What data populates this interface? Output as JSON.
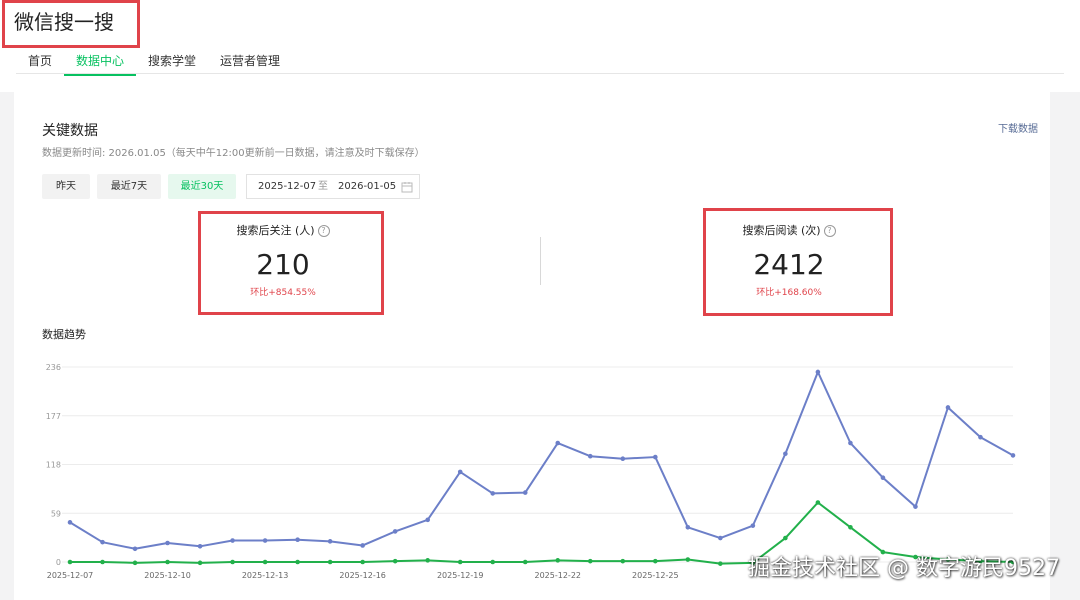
{
  "app": {
    "title": "微信搜一搜"
  },
  "nav": {
    "tabs": [
      "首页",
      "数据中心",
      "搜索学堂",
      "运营者管理"
    ],
    "active_index": 1
  },
  "key_data": {
    "title": "关键数据",
    "updated": "数据更新时间: 2026.01.05（每天中午12:00更新前一日数据，请注意及时下载保存）",
    "download": "下载数据"
  },
  "filters": {
    "buttons": [
      "昨天",
      "最近7天",
      "最近30天"
    ],
    "active_index": 2,
    "date_start": "2025-12-07",
    "date_sep": "至",
    "date_end": "2026-01-05"
  },
  "metrics": [
    {
      "label": "搜索后关注 (人)",
      "value": "210",
      "change": "环比+854.55%"
    },
    {
      "label": "搜索后阅读 (次)",
      "value": "2412",
      "change": "环比+168.60%"
    }
  ],
  "trend": {
    "title": "数据趋势"
  },
  "watermark": "掘金技术社区 @ 数字游民9527",
  "colors": {
    "accent": "#07c160",
    "highlight": "#e0434a",
    "reads": "#6c7fc8",
    "follows": "#22b04b"
  },
  "chart_data": {
    "type": "line",
    "x": [
      "2025-12-07",
      "2025-12-08",
      "2025-12-09",
      "2025-12-10",
      "2025-12-11",
      "2025-12-12",
      "2025-12-13",
      "2025-12-14",
      "2025-12-15",
      "2025-12-16",
      "2025-12-17",
      "2025-12-18",
      "2025-12-19",
      "2025-12-20",
      "2025-12-21",
      "2025-12-22",
      "2025-12-23",
      "2025-12-24",
      "2025-12-25",
      "2025-12-26",
      "2025-12-27",
      "2025-12-28",
      "2025-12-29",
      "2025-12-30",
      "2025-12-31",
      "2026-01-01",
      "2026-01-02",
      "2026-01-03",
      "2026-01-04",
      "2026-01-05"
    ],
    "x_tick_labels": [
      "2025-12-07",
      "2025-12-10",
      "2025-12-13",
      "2025-12-16",
      "2025-12-19",
      "2025-12-22",
      "2025-12-25"
    ],
    "yticks": [
      0,
      59,
      118,
      177,
      236
    ],
    "ylim": [
      0,
      236
    ],
    "grid": true,
    "series": [
      {
        "values": [
          48,
          24,
          16,
          23,
          19,
          26,
          26,
          27,
          25,
          20,
          37,
          51,
          109,
          83,
          84,
          144,
          128,
          125,
          127,
          42,
          29,
          44,
          131,
          230,
          144,
          102,
          67,
          187,
          151,
          129
        ],
        "color": "#6c7fc8"
      },
      {
        "values": [
          0,
          0,
          -1,
          0,
          -1,
          0,
          0,
          0,
          0,
          0,
          1,
          2,
          0,
          0,
          0,
          2,
          1,
          1,
          1,
          3,
          -2,
          -1,
          29,
          72,
          42,
          12,
          6,
          3,
          1,
          0
        ],
        "color": "#22b04b"
      }
    ]
  }
}
